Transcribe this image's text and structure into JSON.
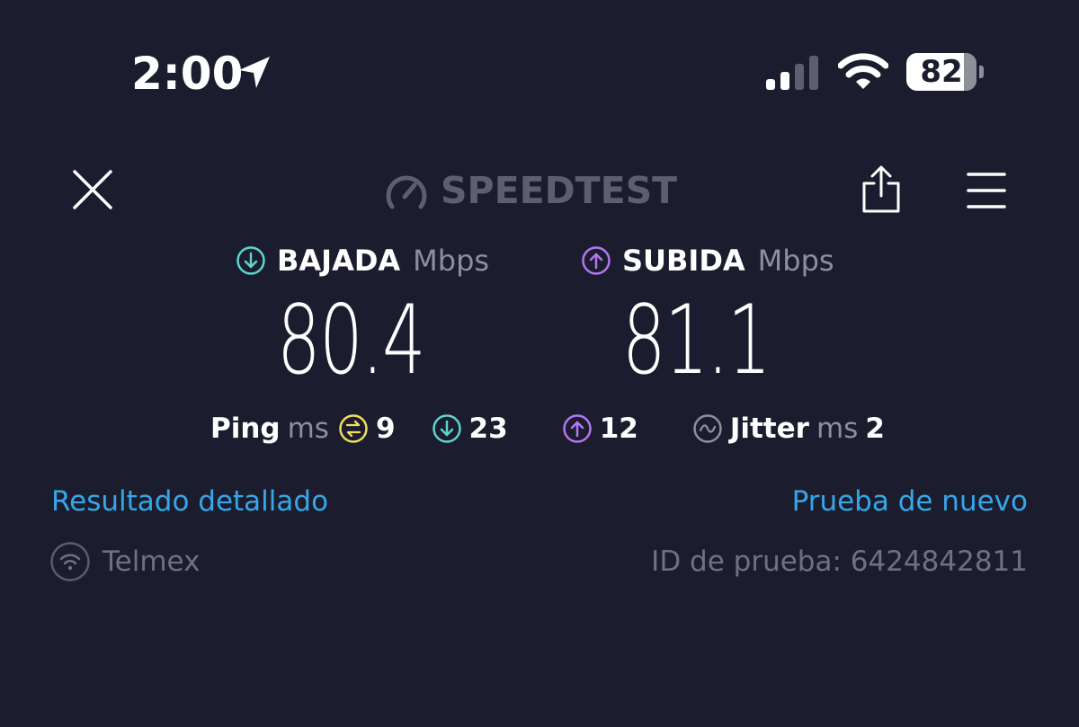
{
  "status_bar": {
    "time": "2:00",
    "battery_level": 82,
    "battery_label": "82",
    "icons": [
      "location-arrow-icon",
      "cellular-signal-icon",
      "wifi-icon",
      "battery-icon"
    ]
  },
  "header": {
    "brand": "SPEEDTEST",
    "icons": [
      "close-icon",
      "speedometer-icon",
      "share-icon",
      "menu-icon"
    ]
  },
  "download": {
    "label": "BAJADA",
    "unit": "Mbps",
    "value": "80.4",
    "color": "#5ed4cd"
  },
  "upload": {
    "label": "SUBIDA",
    "unit": "Mbps",
    "value": "81.1",
    "color": "#b277f0"
  },
  "ping": {
    "label": "Ping",
    "unit": "ms",
    "idle": "9",
    "download": "23",
    "upload": "12",
    "idle_color": "#f2dc5d"
  },
  "jitter": {
    "label": "Jitter",
    "unit": "ms",
    "value": "2"
  },
  "links": {
    "detailed_result": "Resultado detallado",
    "retry": "Prueba de nuevo",
    "color": "#35a7e8"
  },
  "footer": {
    "isp": "Telmex",
    "test_id": "ID de prueba: 6424842811"
  },
  "colors": {
    "background": "#1b1d2e",
    "muted_text": "#8d8f9e"
  }
}
